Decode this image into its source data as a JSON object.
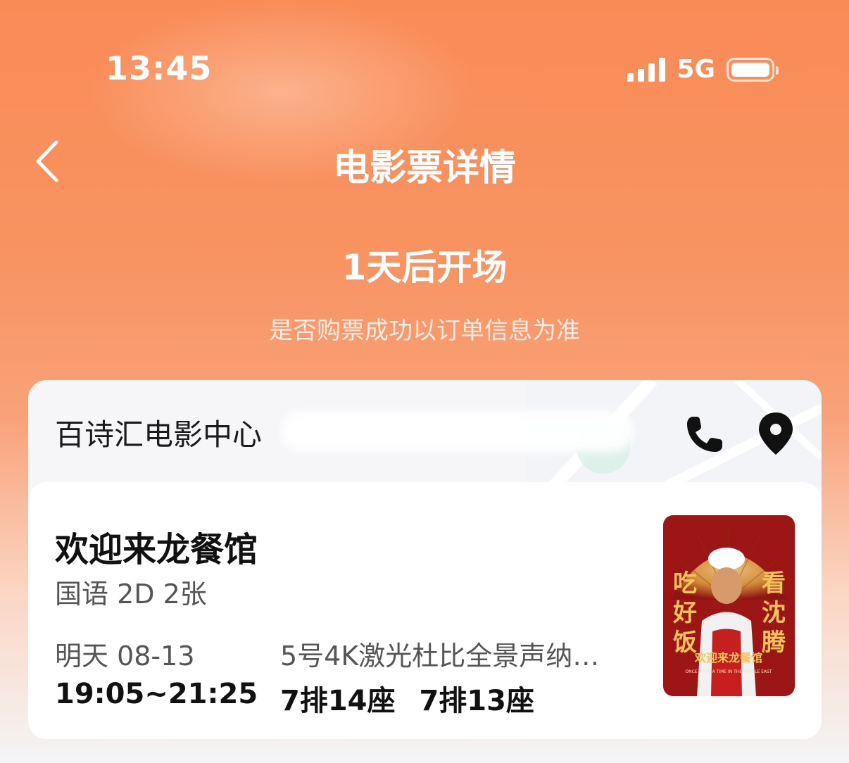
{
  "status_bar": {
    "time": "13:45",
    "network": "5G"
  },
  "header": {
    "title": "电影票详情"
  },
  "countdown": "1天后开场",
  "notice": "是否购票成功以订单信息为准",
  "cinema": {
    "name": "百诗汇电影中心"
  },
  "movie": {
    "title": "欢迎来龙餐馆",
    "meta": "国语 2D 2张",
    "date": "明天 08-13",
    "time": "19:05~21:25",
    "hall": "5号4K激光杜比全景声纳…",
    "seats": [
      "7排14座",
      "7排13座"
    ],
    "poster": {
      "left_text": "吃好饭",
      "right_text": "看沈腾",
      "title_text": "欢迎来龙餐馆",
      "english": "ONCE UPON A TIME IN THE MIDDLE EAST"
    }
  },
  "colors": {
    "accent": "#f98b57",
    "text_dark": "#111111",
    "text_muted": "#555555"
  }
}
